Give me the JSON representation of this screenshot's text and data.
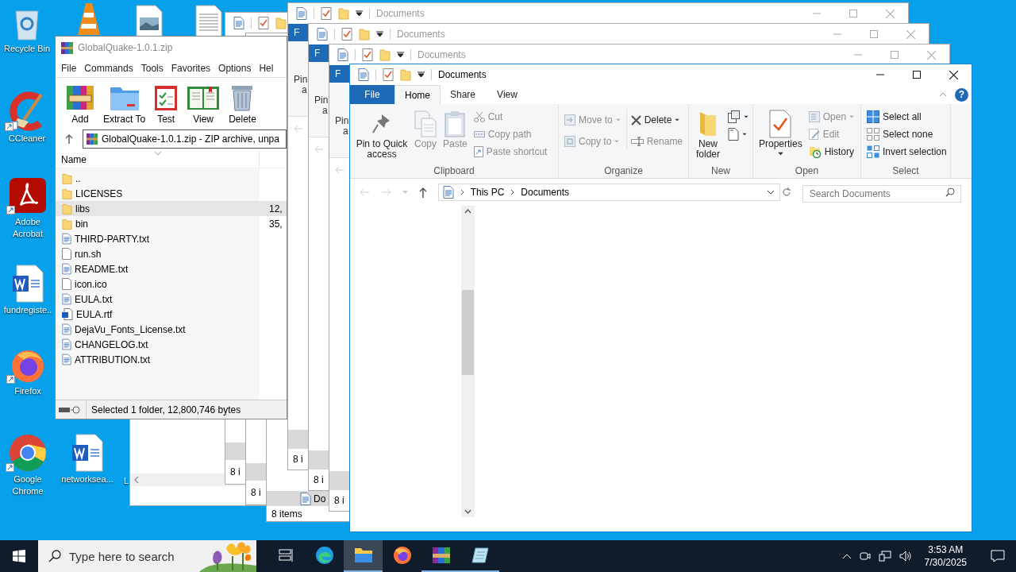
{
  "desktop_icons": [
    {
      "kind": "recycle",
      "label": "Recycle Bin"
    },
    {
      "kind": "cone"
    },
    {
      "kind": "image-doc"
    },
    {
      "kind": "text-doc"
    },
    {
      "kind": "ccleaner",
      "label": "CCleaner"
    },
    {
      "kind": "acrobat",
      "label": "Adobe Acrobat"
    },
    {
      "kind": "word",
      "label": "fundregiste.."
    },
    {
      "kind": "firefox",
      "label": "Firefox"
    },
    {
      "kind": "chrome",
      "label": "Google Chrome"
    },
    {
      "kind": "word",
      "label": "networksea..."
    },
    {
      "kind": "partial",
      "label": "L"
    }
  ],
  "behind_windows": [
    {
      "status": "8 i"
    },
    {
      "status": "8 i"
    },
    {
      "status": "8 items",
      "row": "Do"
    }
  ],
  "stacked_windows": [
    {
      "title": "Documents",
      "file_tab": "F",
      "pin": "Pin",
      "pin_more": "a",
      "status": "8 i"
    },
    {
      "title": "Documents",
      "file_tab": "F",
      "pin": "Pin",
      "pin_more": "a",
      "status": "8 i"
    },
    {
      "title": "Documents",
      "file_tab": "F",
      "pin": "Pin",
      "pin_more": "a",
      "status": "8 i"
    }
  ],
  "winrar": {
    "title": "GlobalQuake-1.0.1.zip",
    "menu": [
      "File",
      "Commands",
      "Tools",
      "Favorites",
      "Options",
      "Hel"
    ],
    "toolbar": [
      "Add",
      "Extract To",
      "Test",
      "View",
      "Delete"
    ],
    "path": "GlobalQuake-1.0.1.zip - ZIP archive, unpa",
    "column": "Name",
    "files": [
      {
        "name": "..",
        "kind": "folder",
        "selected": false
      },
      {
        "name": "LICENSES",
        "kind": "folder",
        "selected": false
      },
      {
        "name": "libs",
        "kind": "folder",
        "size": "12,",
        "selected": true
      },
      {
        "name": "bin",
        "kind": "folder",
        "size": "35,",
        "selected": false
      },
      {
        "name": "THIRD-PARTY.txt",
        "kind": "text",
        "selected": false
      },
      {
        "name": "run.sh",
        "kind": "blank",
        "selected": false
      },
      {
        "name": "README.txt",
        "kind": "text",
        "selected": false
      },
      {
        "name": "icon.ico",
        "kind": "blank",
        "selected": false
      },
      {
        "name": "EULA.txt",
        "kind": "text",
        "selected": false
      },
      {
        "name": "EULA.rtf",
        "kind": "word",
        "selected": false
      },
      {
        "name": "DejaVu_Fonts_License.txt",
        "kind": "text",
        "selected": false
      },
      {
        "name": "CHANGELOG.txt",
        "kind": "text",
        "selected": false
      },
      {
        "name": "ATTRIBUTION.txt",
        "kind": "text",
        "selected": false
      }
    ],
    "status": "Selected 1 folder, 12,800,746 bytes"
  },
  "explorer": {
    "title": "Documents",
    "tabs": [
      {
        "label": "File",
        "kind": "file",
        "selected": false
      },
      {
        "label": "Home",
        "kind": "tab",
        "selected": true
      },
      {
        "label": "Share",
        "kind": "tab",
        "selected": false
      },
      {
        "label": "View",
        "kind": "tab",
        "selected": false
      }
    ],
    "help": "?",
    "groups": [
      {
        "label": "Clipboard",
        "items": [
          {
            "label": "Pin to Quick access",
            "kind": "large",
            "disabled": false
          },
          {
            "label": "Copy",
            "kind": "large",
            "disabled": true
          },
          {
            "label": "Paste",
            "kind": "large",
            "disabled": true
          },
          {
            "label": "Cut",
            "kind": "small",
            "disabled": true
          },
          {
            "label": "Copy path",
            "kind": "small",
            "disabled": true
          },
          {
            "label": "Paste shortcut",
            "kind": "small",
            "disabled": true
          }
        ]
      },
      {
        "label": "Organize",
        "items": [
          {
            "label": "Move to",
            "kind": "small-menu",
            "disabled": true
          },
          {
            "label": "Copy to",
            "kind": "small-menu",
            "disabled": true
          },
          {
            "label": "Delete",
            "kind": "small-menu",
            "disabled": false
          },
          {
            "label": "Rename",
            "kind": "small",
            "disabled": true
          }
        ]
      },
      {
        "label": "New",
        "items": [
          {
            "label": "New folder",
            "kind": "large",
            "disabled": false
          },
          {
            "kind": "icon-menu",
            "disabled": false
          },
          {
            "kind": "icon-menu",
            "disabled": false
          }
        ]
      },
      {
        "label": "Open",
        "items": [
          {
            "label": "Properties",
            "kind": "large-menu",
            "disabled": false
          },
          {
            "label": "Open",
            "kind": "small-menu",
            "disabled": true
          },
          {
            "label": "Edit",
            "kind": "small",
            "disabled": true
          },
          {
            "label": "History",
            "kind": "small",
            "disabled": false
          }
        ]
      },
      {
        "label": "Select",
        "items": [
          {
            "label": "Select all",
            "kind": "small",
            "disabled": false
          },
          {
            "label": "Select none",
            "kind": "small",
            "disabled": false
          },
          {
            "label": "Invert selection",
            "kind": "small",
            "disabled": false
          }
        ]
      }
    ],
    "breadcrumb": [
      "This PC",
      "Documents"
    ],
    "search_placeholder": "Search Documents"
  },
  "taskbar": {
    "search_placeholder": "Type here to search",
    "apps": [
      {
        "kind": "taskview",
        "open": false,
        "selected": false
      },
      {
        "kind": "edge",
        "open": false,
        "selected": false
      },
      {
        "kind": "explorer",
        "open": true,
        "selected": true
      },
      {
        "kind": "firefox",
        "open": false,
        "selected": false
      },
      {
        "kind": "winrar",
        "open": true,
        "selected": false
      },
      {
        "kind": "notepad",
        "open": true,
        "selected": false
      }
    ],
    "time": "3:53 AM",
    "date": "7/30/2025"
  }
}
